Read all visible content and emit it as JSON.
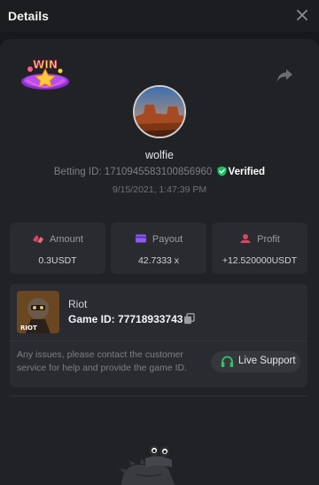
{
  "header": {
    "title": "Details"
  },
  "badge": {
    "text": "WIN"
  },
  "user": {
    "username": "wolfie",
    "betting_id_label": "Betting ID:",
    "betting_id": "1710945583100856960",
    "verified_label": "Verified",
    "date": "9/15/2021, 1:47:39 PM"
  },
  "stats": [
    {
      "label": "Amount",
      "value": "0.3USDT",
      "icon": "coins-icon",
      "color": "#e0445a"
    },
    {
      "label": "Payout",
      "value": "42.7333 x",
      "icon": "wallet-icon",
      "color": "#8c5bf0"
    },
    {
      "label": "Profit",
      "value": "+12.520000USDT",
      "icon": "profit-icon",
      "color": "#e0445a"
    }
  ],
  "game": {
    "name": "Riot",
    "id_label": "Game ID:",
    "id": "77718933743",
    "thumb_text": "RIOT",
    "notice": "Any issues, please contact the customer service for help and provide the game ID.",
    "support_label": "Live Support"
  },
  "colors": {
    "verified": "#16c15e",
    "support_icon": "#2fc46a",
    "background": "#17181b",
    "panel": "#212226",
    "card": "#2a2b30"
  }
}
